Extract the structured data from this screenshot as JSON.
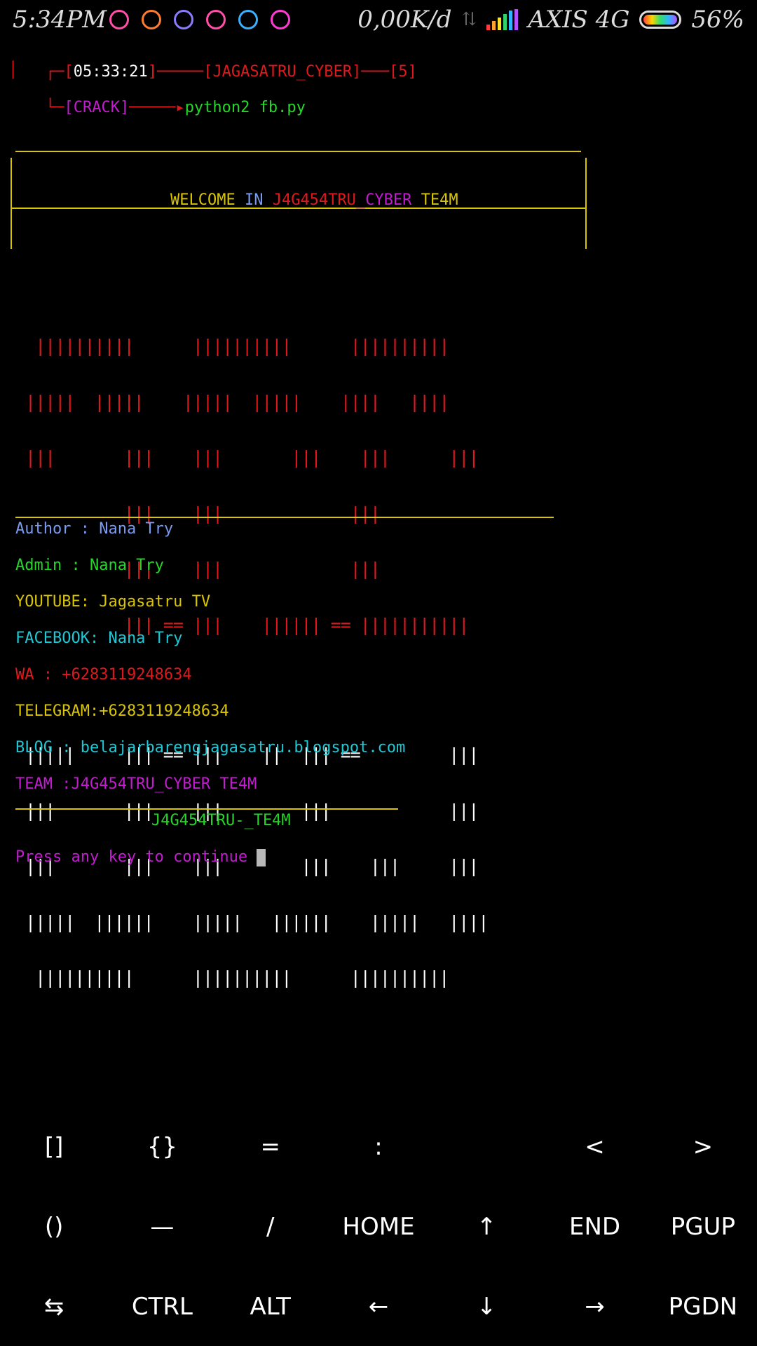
{
  "status_bar": {
    "time": "5:34PM",
    "net_speed": "0,00K/d",
    "carrier": "AXIS 4G",
    "battery": "56%",
    "app_icons": [
      "flower-icon",
      "game-icon",
      "photo-icon",
      "camera-icon",
      "settings-icon",
      "terminal-icon"
    ]
  },
  "prompt": {
    "open_bracket": "[",
    "time": "05:33:21",
    "close_bracket": "]",
    "dash1": "─────",
    "user_open": "[",
    "user": "JAGASATRU_CYBER",
    "user_close": "]",
    "dash2": "───",
    "count": "[5]",
    "dir": "[CRACK]",
    "arrow": "─────▸",
    "command": "python2 fb.py"
  },
  "banner": {
    "welcome": "WELCOME",
    "in": "IN",
    "name_a": "J4G454TRU",
    "name_b": "_CYBER",
    "team": "TE4M"
  },
  "logo_art_red": [
    "  ||||||||||      ||||||||||      ||||||||||",
    " |||||  |||||    |||||  |||||    ||||   ||||",
    " |||       |||    |||       |||    |||      |||",
    "           |||    |||             |||",
    "           |||    |||             |||",
    "           ||| == |||    |||||| == |||||||||||"
  ],
  "logo_art_white": [
    " |||||     ||| == |||    ||  ||| ==         |||",
    " |||       |||    |||        |||            |||",
    " |||       |||    |||        |||    |||     |||",
    " |||||  ||||||    |||||   ||||||    |||||   ||||",
    "  ||||||||||      ||||||||||      ||||||||||"
  ],
  "info": {
    "author": "Author : Nana Try",
    "admin": "Admin : Nana Try",
    "youtube": "YOUTUBE: Jagasatru TV",
    "facebook": "FACEBOOK: Nana Try",
    "wa": "WA : +6283119248634",
    "telegram": "TELEGRAM:+6283119248634",
    "blog": "BLOG : belajarbarengjagasatru.blogspot.com",
    "team": "TEAM :J4G454TRU_CYBER TE4M",
    "footer": "J4G454TRU-_TE4M",
    "press": "Press any key to continue "
  },
  "keyboard": {
    "row1": [
      "[]",
      "{}",
      "=",
      ":",
      "",
      "<",
      ">"
    ],
    "row2": [
      "()",
      "—",
      "/",
      "HOME",
      "↑",
      "END",
      "PGUP"
    ],
    "row3": [
      "⇆",
      "CTRL",
      "ALT",
      "←",
      "↓",
      "→",
      "PGDN"
    ]
  },
  "colors": {
    "red": "#e0181c",
    "yellow": "#d8c400",
    "green": "#27d62a",
    "magenta": "#c21bd0",
    "cyan": "#1ec8d6",
    "blue": "#7a9cf0"
  }
}
